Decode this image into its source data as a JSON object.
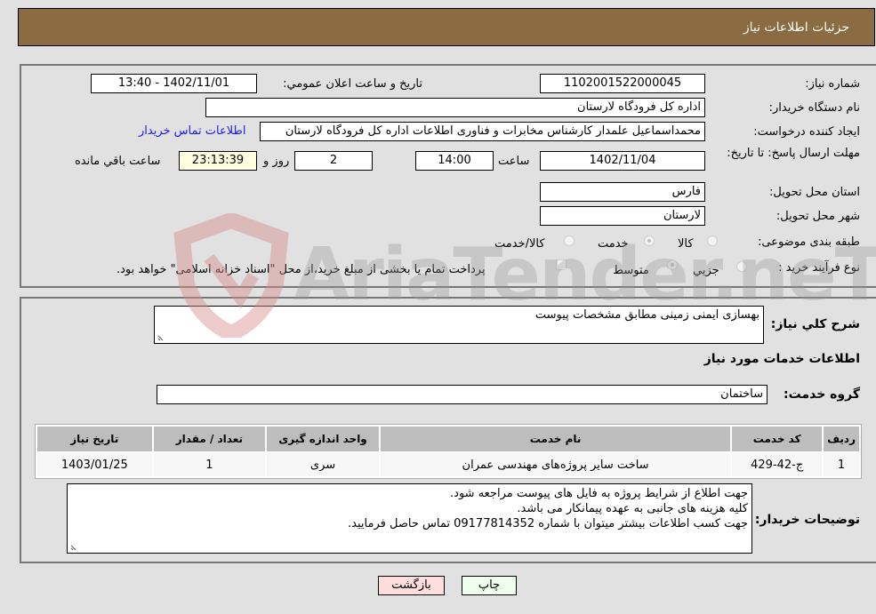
{
  "header": {
    "title": "جزئیات اطلاعات نیاز"
  },
  "form": {
    "need_number_label": "شماره نیاز:",
    "need_number": "1102001522000045",
    "announce_label": "تاریخ و ساعت اعلان عمومي:",
    "announce_value": "1402/11/01 - 13:40",
    "buyer_org_label": "نام دستگاه خريدار:",
    "buyer_org": "اداره کل فرودگاه لارستان",
    "creator_label": "ایجاد کننده درخواست:",
    "creator": "محمداسماعیل علمدار کارشناس مخابرات و فناوری اطلاعات اداره کل فرودگاه لارستان",
    "buyer_contact_link": "اطلاعات تماس خریدار",
    "deadline_label": "مهلت ارسال پاسخ: تا تاریخ:",
    "deadline_date": "1402/11/04",
    "time_label": "ساعت",
    "deadline_time": "14:00",
    "days_value": "2",
    "days_label": "روز و",
    "remaining_time": "23:13:39",
    "remaining_label": "ساعت باقي مانده",
    "province_label": "استان محل تحویل:",
    "province": "فارس",
    "city_label": "شهر محل تحویل:",
    "city": "لارستان",
    "category_label": "طبقه بندی موضوعی:",
    "category_options": [
      {
        "label": "کالا",
        "selected": false
      },
      {
        "label": "خدمت",
        "selected": true
      },
      {
        "label": "کالا/خدمت",
        "selected": false
      }
    ],
    "process_label": "نوع فرآیند خرید :",
    "process_options": [
      {
        "label": "جزيي",
        "selected": false
      },
      {
        "label": "متوسط",
        "selected": true
      }
    ],
    "treasury_checkbox_label": "پرداخت تمام یا بخشی از مبلغ خرید،از محل \"اسناد خزانه اسلامی\" خواهد بود.",
    "treasury_checked": false
  },
  "details": {
    "summary_label": "شرح کلي نياز:",
    "summary": "بهسازی ایمنی زمینی مطابق مشخصات پیوست",
    "services_heading": "اطلاعات خدمات مورد نیاز",
    "service_group_label": "گروه خدمت:",
    "service_group": "ساختمان",
    "table": {
      "headers": [
        "رديف",
        "کد خدمت",
        "نام خدمت",
        "واحد اندازه گیری",
        "تعداد / مقدار",
        "تاریخ نیاز"
      ],
      "rows": [
        [
          "1",
          "ج-42-429",
          "ساخت سایر پروژه‌های مهندسی عمران",
          "سری",
          "1",
          "1403/01/25"
        ]
      ]
    },
    "buyer_notes_label": "توضیحات خریدار:",
    "buyer_notes": [
      "جهت اطلاع از شرایط پروژه به فایل های پیوست مراجعه شود.",
      "کلیه هزینه های جانبی به عهده پیمانکار می باشد.",
      "جهت کسب اطلاعات بیشتر میتوان با شماره 09177814352 تماس حاصل فرمایید."
    ]
  },
  "buttons": {
    "print": "چاپ",
    "back": "بازگشت"
  },
  "watermark": {
    "text": "AriaTender.neT"
  },
  "colors": {
    "header_bg": "#8b6c42",
    "link": "#1a1aee",
    "print_bg": "#eeffee",
    "back_bg": "#ffdddd",
    "remaining_bg": "#ffffe0"
  }
}
